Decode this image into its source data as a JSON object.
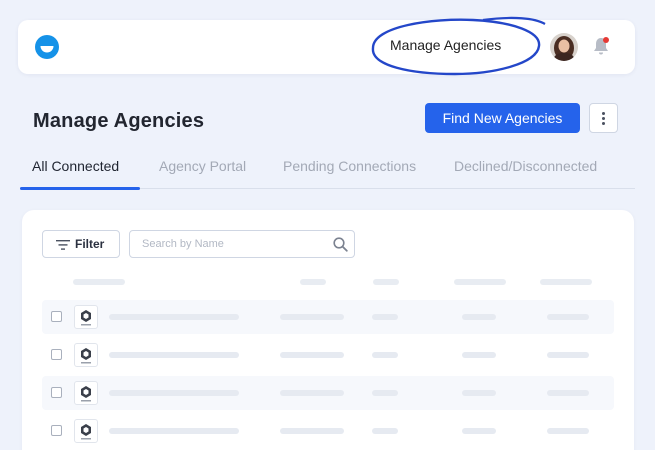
{
  "topbar": {
    "nav_link": "Manage Agencies",
    "annotation_color": "#2447c9",
    "notification_dot_color": "#e53935",
    "icons": [
      "logo-icon",
      "avatar",
      "bell-icon"
    ]
  },
  "page": {
    "title": "Manage Agencies",
    "primary_button": "Find New Agencies",
    "more_button_icon": "vertical-dots-icon",
    "accent_color": "#2563eb"
  },
  "tabs": [
    {
      "label": "All Connected",
      "active": true
    },
    {
      "label": "Agency Portal",
      "active": false
    },
    {
      "label": "Pending Connections",
      "active": false
    },
    {
      "label": "Declined/Disconnected",
      "active": false
    }
  ],
  "table": {
    "filter_label": "Filter",
    "search_placeholder": "Search by Name",
    "rows": 4
  }
}
